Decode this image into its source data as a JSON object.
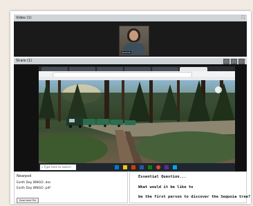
{
  "video_pod": {
    "title": "Video",
    "badge": "(1)",
    "webcam_name": "Sarah W."
  },
  "share_pod": {
    "title": "Share",
    "badge": "(1)"
  },
  "taskbar": {
    "search_placeholder": "Type here to search"
  },
  "files_pod": {
    "title": "Nearpod",
    "files": [
      "Earth Day BINGO .doc",
      "Earth Day BINGO .pdf"
    ],
    "download_label": "Download File"
  },
  "note_pod": {
    "lines": [
      "Essential Question...",
      "What would it be like to",
      "be the first person to discover the Sequoia tree?"
    ]
  }
}
